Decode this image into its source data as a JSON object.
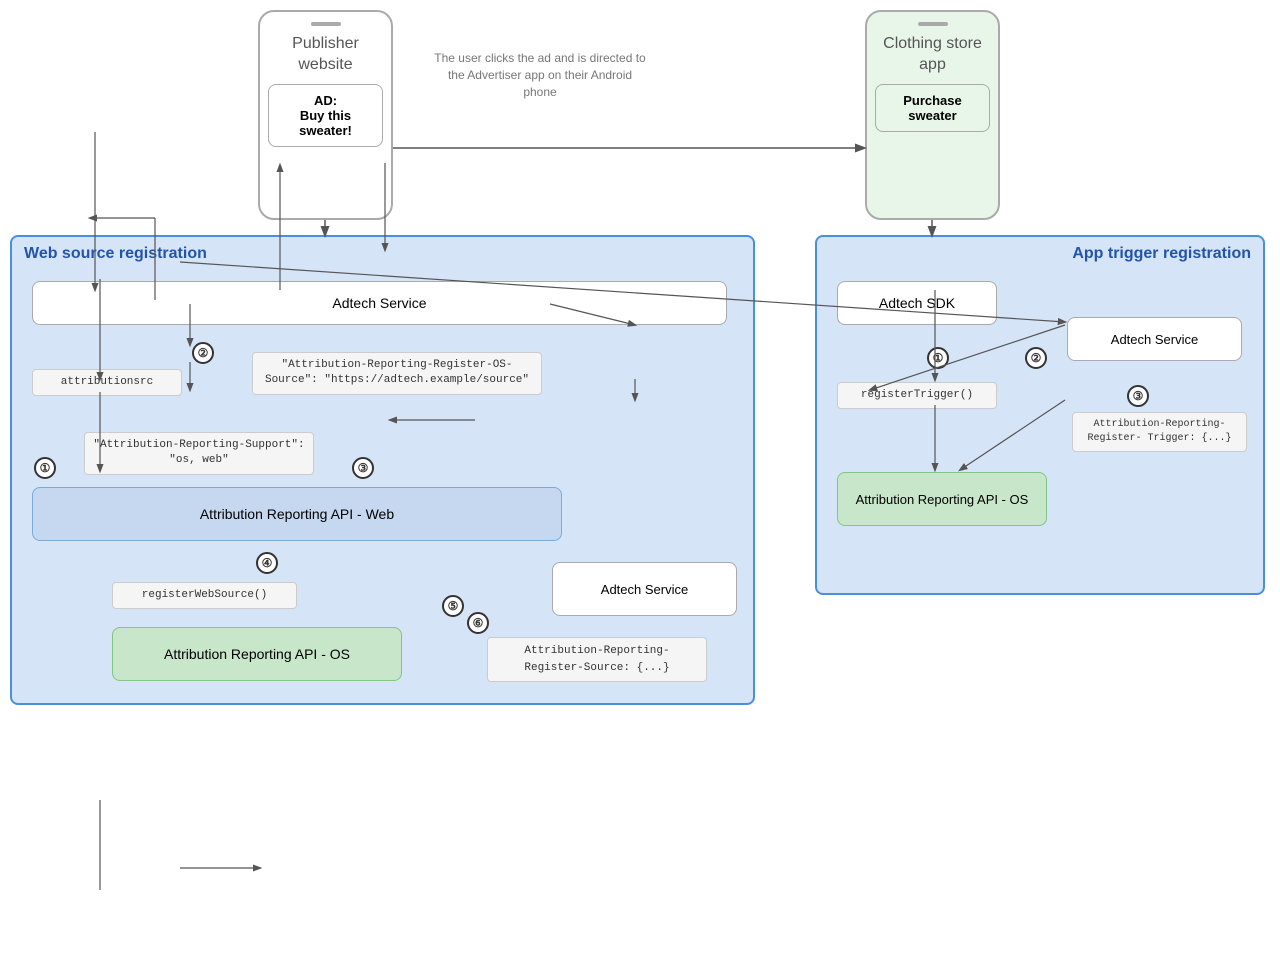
{
  "publisher_phone": {
    "title": "Publisher website",
    "ad_label": "AD:",
    "ad_text": "Buy this sweater!"
  },
  "clothing_phone": {
    "title": "Clothing store app",
    "button": "Purchase sweater"
  },
  "arrow_label": {
    "text": "The user clicks the ad and is directed to the Advertiser app on their Android phone"
  },
  "left_box": {
    "title": "Web source registration",
    "adtech_service_top": "Adtech Service",
    "attribution_src": "attributionsrc",
    "header_response": "\"Attribution-Reporting-Register-OS-Source\":\n\"https://adtech.example/source\"",
    "support_header": "\"Attribution-Reporting-Support\": \"os, web\"",
    "api_web": "Attribution Reporting API - Web",
    "register_web": "registerWebSource()",
    "adtech_service_bottom": "Adtech Service",
    "register_source_header": "Attribution-Reporting-\nRegister-Source: {...}",
    "api_os": "Attribution Reporting API - OS"
  },
  "right_box": {
    "title": "App trigger registration",
    "adtech_sdk": "Adtech SDK",
    "register_trigger": "registerTrigger()",
    "adtech_service": "Adtech Service",
    "register_trigger_header": "Attribution-Reporting-Register-\nTrigger: {...}",
    "api_os": "Attribution Reporting API - OS"
  },
  "numbers": {
    "left": [
      "①",
      "②",
      "③",
      "④",
      "⑤",
      "⑥"
    ],
    "right": [
      "①",
      "②",
      "③"
    ]
  }
}
